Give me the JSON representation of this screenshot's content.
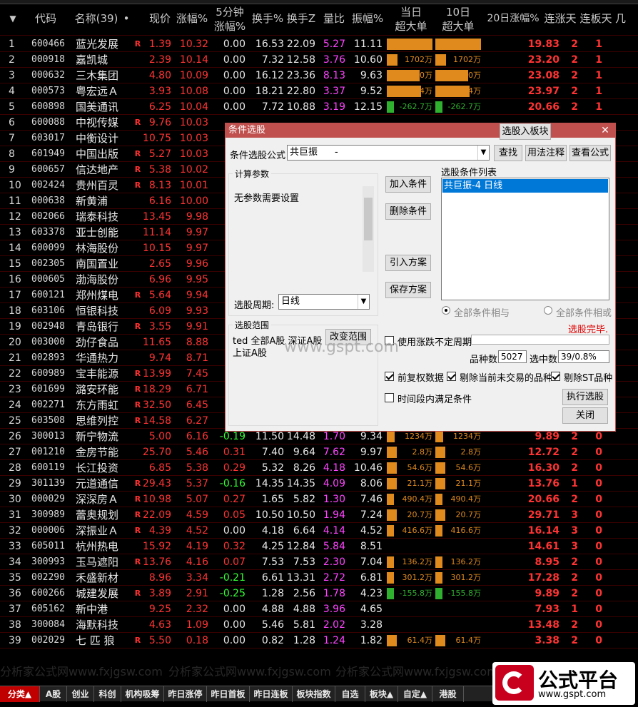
{
  "headers": {
    "code": "代码",
    "name": "名称(39)",
    "dot": "•",
    "price": "现价",
    "change": "涨幅%",
    "min5_1": "5分钟",
    "min5_2": "涨幅%",
    "turnover": "换手%",
    "turnover_z": "换手Z",
    "volume_ratio": "量比",
    "amplitude": "振幅%",
    "big_today_1": "当日",
    "big_today_2": "超大单",
    "big_10d_1": "10日",
    "big_10d_2": "超大单",
    "change_20d": "20日涨幅%",
    "up_days": "连涨天",
    "limit_days": "连板天",
    "extra": "几"
  },
  "rows": [
    {
      "n": "1",
      "code": "600466",
      "name": "蓝光发展",
      "flag": "R",
      "price": "1.39",
      "chg": "10.32",
      "m5": "0.00",
      "turn": "16.53",
      "turnz": "22.09",
      "lb": "5.27",
      "amp": "11.11",
      "today": "7208万",
      "tenday": "7208万",
      "today_v": 7208,
      "ten_v": 7208,
      "d20": "19.83",
      "lz": "2",
      "lbd": "1"
    },
    {
      "n": "2",
      "code": "000918",
      "name": "嘉凯城",
      "flag": "",
      "price": "2.39",
      "chg": "10.14",
      "m5": "0.00",
      "turn": "7.32",
      "turnz": "12.58",
      "lb": "3.76",
      "amp": "10.60",
      "today": "1702万",
      "tenday": "1702万",
      "today_v": 1702,
      "ten_v": 1702,
      "d20": "23.20",
      "lz": "2",
      "lbd": "1"
    },
    {
      "n": "3",
      "code": "000632",
      "name": "三木集团",
      "flag": "",
      "price": "4.80",
      "chg": "10.09",
      "m5": "0.00",
      "turn": "16.12",
      "turnz": "23.36",
      "lb": "8.13",
      "amp": "9.63",
      "today": "5200万",
      "tenday": "5200万",
      "today_v": 5200,
      "ten_v": 5200,
      "d20": "23.08",
      "lz": "2",
      "lbd": "1"
    },
    {
      "n": "4",
      "code": "000573",
      "name": "粤宏远Ａ",
      "flag": "",
      "price": "3.93",
      "chg": "10.08",
      "m5": "0.00",
      "turn": "18.21",
      "turnz": "22.80",
      "lb": "3.37",
      "amp": "9.52",
      "today": "5364万",
      "tenday": "5364万",
      "today_v": 5364,
      "ten_v": 5364,
      "d20": "23.97",
      "lz": "2",
      "lbd": "1"
    },
    {
      "n": "5",
      "code": "600898",
      "name": "国美通讯",
      "flag": "",
      "price": "6.25",
      "chg": "10.04",
      "m5": "0.00",
      "turn": "7.72",
      "turnz": "10.88",
      "lb": "3.19",
      "amp": "12.15",
      "today": "-262.7万",
      "tenday": "-262.7万",
      "today_v": -262.7,
      "ten_v": -262.7,
      "d20": "20.66",
      "lz": "2",
      "lbd": "1"
    },
    {
      "n": "6",
      "code": "600088",
      "name": "中视传媒",
      "flag": "R",
      "price": "9.76",
      "chg": "10.03",
      "m5": "",
      "turn": "",
      "turnz": "",
      "lb": "",
      "amp": "",
      "today": "",
      "tenday": "",
      "today_v": 0,
      "ten_v": 0,
      "d20": "",
      "lz": "",
      "lbd": ""
    },
    {
      "n": "7",
      "code": "603017",
      "name": "中衡设计",
      "flag": "",
      "price": "10.75",
      "chg": "10.03",
      "m5": "",
      "turn": "",
      "turnz": "",
      "lb": "",
      "amp": "",
      "today": "",
      "tenday": "",
      "today_v": 0,
      "ten_v": 0,
      "d20": "",
      "lz": "",
      "lbd": ""
    },
    {
      "n": "8",
      "code": "601949",
      "name": "中国出版",
      "flag": "R",
      "price": "5.27",
      "chg": "10.03",
      "m5": "",
      "turn": "",
      "turnz": "",
      "lb": "",
      "amp": "",
      "today": "",
      "tenday": "",
      "today_v": 0,
      "ten_v": 0,
      "d20": "",
      "lz": "",
      "lbd": ""
    },
    {
      "n": "9",
      "code": "600657",
      "name": "信达地产",
      "flag": "R",
      "price": "5.38",
      "chg": "10.02",
      "m5": "",
      "turn": "",
      "turnz": "",
      "lb": "",
      "amp": "",
      "today": "",
      "tenday": "",
      "today_v": 0,
      "ten_v": 0,
      "d20": "",
      "lz": "",
      "lbd": ""
    },
    {
      "n": "10",
      "code": "002424",
      "name": "贵州百灵",
      "flag": "R",
      "price": "8.13",
      "chg": "10.01",
      "m5": "",
      "turn": "",
      "turnz": "",
      "lb": "",
      "amp": "",
      "today": "",
      "tenday": "",
      "today_v": 0,
      "ten_v": 0,
      "d20": "",
      "lz": "",
      "lbd": ""
    },
    {
      "n": "11",
      "code": "000638",
      "name": "新黄浦",
      "flag": "",
      "price": "6.16",
      "chg": "10.00",
      "m5": "",
      "turn": "",
      "turnz": "",
      "lb": "",
      "amp": "",
      "today": "",
      "tenday": "",
      "today_v": 0,
      "ten_v": 0,
      "d20": "",
      "lz": "",
      "lbd": ""
    },
    {
      "n": "12",
      "code": "002066",
      "name": "瑞泰科技",
      "flag": "",
      "price": "13.45",
      "chg": "9.98",
      "m5": "",
      "turn": "",
      "turnz": "",
      "lb": "",
      "amp": "",
      "today": "",
      "tenday": "",
      "today_v": 0,
      "ten_v": 0,
      "d20": "",
      "lz": "",
      "lbd": ""
    },
    {
      "n": "13",
      "code": "603378",
      "name": "亚士创能",
      "flag": "",
      "price": "11.14",
      "chg": "9.97",
      "m5": "",
      "turn": "",
      "turnz": "",
      "lb": "",
      "amp": "",
      "today": "",
      "tenday": "",
      "today_v": 0,
      "ten_v": 0,
      "d20": "",
      "lz": "",
      "lbd": ""
    },
    {
      "n": "14",
      "code": "600099",
      "name": "林海股份",
      "flag": "",
      "price": "10.15",
      "chg": "9.97",
      "m5": "",
      "turn": "",
      "turnz": "",
      "lb": "",
      "amp": "",
      "today": "",
      "tenday": "",
      "today_v": 0,
      "ten_v": 0,
      "d20": "",
      "lz": "",
      "lbd": ""
    },
    {
      "n": "15",
      "code": "002305",
      "name": "南国置业",
      "flag": "",
      "price": "2.65",
      "chg": "9.96",
      "m5": "",
      "turn": "",
      "turnz": "",
      "lb": "",
      "amp": "",
      "today": "",
      "tenday": "",
      "today_v": 0,
      "ten_v": 0,
      "d20": "",
      "lz": "",
      "lbd": ""
    },
    {
      "n": "16",
      "code": "000605",
      "name": "渤海股份",
      "flag": "",
      "price": "6.96",
      "chg": "9.95",
      "m5": "",
      "turn": "",
      "turnz": "",
      "lb": "",
      "amp": "",
      "today": "",
      "tenday": "",
      "today_v": 0,
      "ten_v": 0,
      "d20": "",
      "lz": "",
      "lbd": ""
    },
    {
      "n": "17",
      "code": "600121",
      "name": "郑州煤电",
      "flag": "R",
      "price": "5.64",
      "chg": "9.94",
      "m5": "",
      "turn": "",
      "turnz": "",
      "lb": "",
      "amp": "",
      "today": "",
      "tenday": "",
      "today_v": 0,
      "ten_v": 0,
      "d20": "",
      "lz": "",
      "lbd": ""
    },
    {
      "n": "18",
      "code": "603106",
      "name": "恒银科技",
      "flag": "",
      "price": "6.09",
      "chg": "9.93",
      "m5": "",
      "turn": "",
      "turnz": "",
      "lb": "",
      "amp": "",
      "today": "",
      "tenday": "",
      "today_v": 0,
      "ten_v": 0,
      "d20": "",
      "lz": "",
      "lbd": ""
    },
    {
      "n": "19",
      "code": "002948",
      "name": "青岛银行",
      "flag": "R",
      "price": "3.55",
      "chg": "9.91",
      "m5": "",
      "turn": "",
      "turnz": "",
      "lb": "",
      "amp": "",
      "today": "",
      "tenday": "",
      "today_v": 0,
      "ten_v": 0,
      "d20": "",
      "lz": "",
      "lbd": ""
    },
    {
      "n": "20",
      "code": "003000",
      "name": "劲仔食品",
      "flag": "",
      "price": "11.65",
      "chg": "8.88",
      "m5": "",
      "turn": "",
      "turnz": "",
      "lb": "",
      "amp": "",
      "today": "",
      "tenday": "",
      "today_v": 0,
      "ten_v": 0,
      "d20": "",
      "lz": "",
      "lbd": ""
    },
    {
      "n": "21",
      "code": "002893",
      "name": "华通热力",
      "flag": "",
      "price": "9.74",
      "chg": "8.71",
      "m5": "",
      "turn": "",
      "turnz": "",
      "lb": "",
      "amp": "",
      "today": "",
      "tenday": "",
      "today_v": 0,
      "ten_v": 0,
      "d20": "",
      "lz": "",
      "lbd": ""
    },
    {
      "n": "22",
      "code": "600989",
      "name": "宝丰能源",
      "flag": "R",
      "price": "13.99",
      "chg": "7.45",
      "m5": "",
      "turn": "",
      "turnz": "",
      "lb": "",
      "amp": "",
      "today": "",
      "tenday": "",
      "today_v": 0,
      "ten_v": 0,
      "d20": "",
      "lz": "",
      "lbd": ""
    },
    {
      "n": "23",
      "code": "601699",
      "name": "潞安环能",
      "flag": "R",
      "price": "18.29",
      "chg": "6.71",
      "m5": "",
      "turn": "",
      "turnz": "",
      "lb": "",
      "amp": "",
      "today": "",
      "tenday": "",
      "today_v": 0,
      "ten_v": 0,
      "d20": "",
      "lz": "",
      "lbd": ""
    },
    {
      "n": "24",
      "code": "002271",
      "name": "东方雨虹",
      "flag": "R",
      "price": "32.50",
      "chg": "6.45",
      "m5": "",
      "turn": "",
      "turnz": "",
      "lb": "",
      "amp": "",
      "today": "",
      "tenday": "",
      "today_v": 0,
      "ten_v": 0,
      "d20": "",
      "lz": "",
      "lbd": ""
    },
    {
      "n": "25",
      "code": "603508",
      "name": "思维列控",
      "flag": "R",
      "price": "14.58",
      "chg": "6.27",
      "m5": "",
      "turn": "",
      "turnz": "",
      "lb": "",
      "amp": "",
      "today": "",
      "tenday": "",
      "today_v": 0,
      "ten_v": 0,
      "d20": "",
      "lz": "",
      "lbd": ""
    },
    {
      "n": "26",
      "code": "300013",
      "name": "新宁物流",
      "flag": "",
      "price": "5.00",
      "chg": "6.16",
      "m5": "-0.19",
      "turn": "11.50",
      "turnz": "14.48",
      "lb": "1.70",
      "amp": "9.34",
      "today": "1234万",
      "tenday": "1234万",
      "today_v": 1234,
      "ten_v": 1234,
      "d20": "9.89",
      "lz": "2",
      "lbd": "0"
    },
    {
      "n": "27",
      "code": "001210",
      "name": "金房节能",
      "flag": "",
      "price": "25.70",
      "chg": "5.46",
      "m5": "0.31",
      "turn": "7.40",
      "turnz": "9.64",
      "lb": "7.62",
      "amp": "9.97",
      "today": "2.8万",
      "tenday": "2.8万",
      "today_v": 2.8,
      "ten_v": 2.8,
      "d20": "12.72",
      "lz": "2",
      "lbd": "0"
    },
    {
      "n": "28",
      "code": "600119",
      "name": "长江投资",
      "flag": "",
      "price": "6.85",
      "chg": "5.38",
      "m5": "0.29",
      "turn": "5.32",
      "turnz": "8.26",
      "lb": "4.18",
      "amp": "10.46",
      "today": "54.6万",
      "tenday": "54.6万",
      "today_v": 54.6,
      "ten_v": 54.6,
      "d20": "16.30",
      "lz": "2",
      "lbd": "0"
    },
    {
      "n": "29",
      "code": "301139",
      "name": "元道通信",
      "flag": "R",
      "price": "29.43",
      "chg": "5.37",
      "m5": "-0.16",
      "turn": "14.35",
      "turnz": "14.35",
      "lb": "4.09",
      "amp": "8.06",
      "today": "21.1万",
      "tenday": "21.1万",
      "today_v": 21.1,
      "ten_v": 21.1,
      "d20": "13.76",
      "lz": "1",
      "lbd": "0"
    },
    {
      "n": "30",
      "code": "000029",
      "name": "深深房Ａ",
      "flag": "R",
      "price": "10.98",
      "chg": "5.07",
      "m5": "0.27",
      "turn": "1.65",
      "turnz": "5.82",
      "lb": "1.30",
      "amp": "7.46",
      "today": "490.4万",
      "tenday": "490.4万",
      "today_v": 490.4,
      "ten_v": 490.4,
      "d20": "20.66",
      "lz": "2",
      "lbd": "0"
    },
    {
      "n": "31",
      "code": "300989",
      "name": "蕾奥规划",
      "flag": "R",
      "price": "22.09",
      "chg": "4.59",
      "m5": "0.05",
      "turn": "10.50",
      "turnz": "10.50",
      "lb": "1.94",
      "amp": "7.24",
      "today": "20.7万",
      "tenday": "20.7万",
      "today_v": 20.7,
      "ten_v": 20.7,
      "d20": "29.71",
      "lz": "3",
      "lbd": "0"
    },
    {
      "n": "32",
      "code": "000006",
      "name": "深振业Ａ",
      "flag": "R",
      "price": "4.39",
      "chg": "4.52",
      "m5": "0.00",
      "turn": "4.18",
      "turnz": "6.64",
      "lb": "4.14",
      "amp": "4.52",
      "today": "416.6万",
      "tenday": "416.6万",
      "today_v": 416.6,
      "ten_v": 416.6,
      "d20": "16.14",
      "lz": "3",
      "lbd": "0"
    },
    {
      "n": "33",
      "code": "605011",
      "name": "杭州热电",
      "flag": "",
      "price": "15.92",
      "chg": "4.19",
      "m5": "0.32",
      "turn": "4.25",
      "turnz": "12.84",
      "lb": "5.84",
      "amp": "8.51",
      "today": "",
      "tenday": "",
      "today_v": 0,
      "ten_v": 0,
      "d20": "14.61",
      "lz": "3",
      "lbd": "0"
    },
    {
      "n": "34",
      "code": "300993",
      "name": "玉马遮阳",
      "flag": "R",
      "price": "13.76",
      "chg": "4.16",
      "m5": "0.07",
      "turn": "7.53",
      "turnz": "7.53",
      "lb": "2.30",
      "amp": "7.04",
      "today": "136.2万",
      "tenday": "136.2万",
      "today_v": 136.2,
      "ten_v": 136.2,
      "d20": "8.95",
      "lz": "2",
      "lbd": "0"
    },
    {
      "n": "35",
      "code": "002290",
      "name": "禾盛新材",
      "flag": "",
      "price": "8.96",
      "chg": "3.34",
      "m5": "-0.21",
      "turn": "6.61",
      "turnz": "13.31",
      "lb": "2.72",
      "amp": "6.81",
      "today": "301.2万",
      "tenday": "301.2万",
      "today_v": 301.2,
      "ten_v": 301.2,
      "d20": "17.28",
      "lz": "2",
      "lbd": "0"
    },
    {
      "n": "36",
      "code": "600266",
      "name": "城建发展",
      "flag": "R",
      "price": "3.89",
      "chg": "2.91",
      "m5": "-0.25",
      "turn": "1.28",
      "turnz": "2.56",
      "lb": "1.78",
      "amp": "4.23",
      "today": "-155.8万",
      "tenday": "-155.8万",
      "today_v": -155.8,
      "ten_v": -155.8,
      "d20": "9.89",
      "lz": "2",
      "lbd": "0"
    },
    {
      "n": "37",
      "code": "605162",
      "name": "新中港",
      "flag": "",
      "price": "9.25",
      "chg": "2.32",
      "m5": "0.00",
      "turn": "4.88",
      "turnz": "4.88",
      "lb": "3.96",
      "amp": "4.65",
      "today": "",
      "tenday": "",
      "today_v": 0,
      "ten_v": 0,
      "d20": "7.93",
      "lz": "1",
      "lbd": "0"
    },
    {
      "n": "38",
      "code": "300084",
      "name": "海默科技",
      "flag": "",
      "price": "4.63",
      "chg": "1.09",
      "m5": "0.00",
      "turn": "5.46",
      "turnz": "5.81",
      "lb": "2.02",
      "amp": "3.28",
      "today": "",
      "tenday": "",
      "today_v": 0,
      "ten_v": 0,
      "d20": "13.48",
      "lz": "2",
      "lbd": "0"
    },
    {
      "n": "39",
      "code": "002029",
      "name": "七 匹 狼",
      "flag": "R",
      "price": "5.50",
      "chg": "0.18",
      "m5": "0.00",
      "turn": "0.82",
      "turnz": "1.28",
      "lb": "1.24",
      "amp": "1.82",
      "today": "61.4万",
      "tenday": "61.4万",
      "today_v": 61.4,
      "ten_v": 61.4,
      "d20": "3.38",
      "lz": "2",
      "lbd": "0"
    }
  ],
  "dialog": {
    "title": "条件选股",
    "formula_label": "条件选股公式",
    "formula_value": "共巨振",
    "formula_dash": "-",
    "btn_find": "查找",
    "btn_usage": "用法注释",
    "btn_view": "查看公式",
    "params_title": "计算参数",
    "params_text": "无参数需要设置",
    "btn_add": "加入条件",
    "btn_delete": "删除条件",
    "btn_import": "引入方案",
    "btn_save": "保存方案",
    "list_title": "选股条件列表",
    "list_item": "共巨振-4  日线",
    "period_label": "选股周期:",
    "period_value": "日线",
    "radio_and": "全部条件相与",
    "radio_or": "全部条件相或",
    "status": "选股完毕.",
    "scope_title": "选股范围",
    "scope_text1": "ted 全部A股 深证A股",
    "scope_text2": "上证A股",
    "btn_scope": "改变范围",
    "chk_period": "使用涨跌不定周期",
    "count_label": "品种数",
    "count_value": "5027",
    "select_label": "选中数",
    "select_value": "39/0.8%",
    "chk_fq": "前复权数据",
    "chk_untraded": "剔除当前未交易的品种",
    "chk_st": "剔除ST品种",
    "chk_timeframe": "时间段内满足条件",
    "btn_to_block": "选股入板块",
    "btn_run": "执行选股",
    "btn_close": "关闭"
  },
  "watermark": {
    "site": "www.gspt.com",
    "text": "分析家公式网www.fxjgsw.com"
  },
  "tabs": [
    "分类▲",
    "A股",
    "创业",
    "科创",
    "机构吸筹",
    "昨日涨停",
    "昨日首板",
    "昨日连板",
    "板块指数",
    "自选",
    "板块▲",
    "自定▲",
    "港股"
  ],
  "logo": {
    "text": "公式平台",
    "url": "www.gspt.com"
  },
  "colors": {
    "up": "#ff3333",
    "down": "#33ff33",
    "bar": "#e08a1e",
    "dialog_accent": "#c0504d"
  }
}
